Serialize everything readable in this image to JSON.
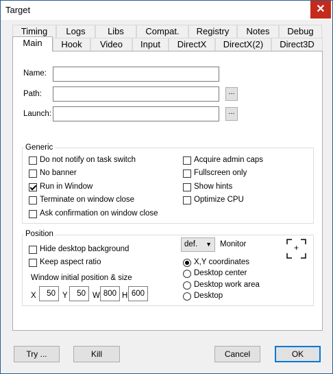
{
  "window": {
    "title": "Target",
    "close_symbol": "✕"
  },
  "tabs_row1": [
    "Timing",
    "Logs",
    "Libs",
    "Compat.",
    "Registry",
    "Notes",
    "Debug"
  ],
  "tabs_row2": [
    "Main",
    "Hook",
    "Video",
    "Input",
    "DirectX",
    "DirectX(2)",
    "Direct3D"
  ],
  "active_tab": "Main",
  "fields": {
    "name_label": "Name:",
    "name_value": "",
    "path_label": "Path:",
    "path_value": "",
    "launch_label": "Launch:",
    "launch_value": "",
    "browse_label": "..."
  },
  "generic": {
    "title": "Generic",
    "left": [
      {
        "label": "Do not notify on task switch",
        "checked": false
      },
      {
        "label": "No banner",
        "checked": false
      },
      {
        "label": "Run in Window",
        "checked": true
      },
      {
        "label": "Terminate on window close",
        "checked": false
      },
      {
        "label": "Ask confirmation on window close",
        "checked": false
      }
    ],
    "right": [
      {
        "label": "Acquire admin caps",
        "checked": false
      },
      {
        "label": "Fullscreen only",
        "checked": false
      },
      {
        "label": "Show hints",
        "checked": false
      },
      {
        "label": "Optimize CPU",
        "checked": false
      }
    ]
  },
  "position": {
    "title": "Position",
    "checks": [
      {
        "label": "Hide desktop background",
        "checked": false
      },
      {
        "label": "Keep aspect ratio",
        "checked": false
      }
    ],
    "monitor_select": "def.",
    "monitor_label": "Monitor",
    "crosshair_symbol": "+",
    "radios": [
      {
        "label": "X,Y coordinates",
        "checked": true
      },
      {
        "label": "Desktop center",
        "checked": false
      },
      {
        "label": "Desktop work area",
        "checked": false
      },
      {
        "label": "Desktop",
        "checked": false
      }
    ],
    "size_label": "Window initial position & size",
    "x_label": "X",
    "x_value": "50",
    "y_label": "Y",
    "y_value": "50",
    "w_label": "W",
    "w_value": "800",
    "h_label": "H",
    "h_value": "600"
  },
  "buttons": {
    "try": "Try ...",
    "kill": "Kill",
    "cancel": "Cancel",
    "ok": "OK"
  }
}
